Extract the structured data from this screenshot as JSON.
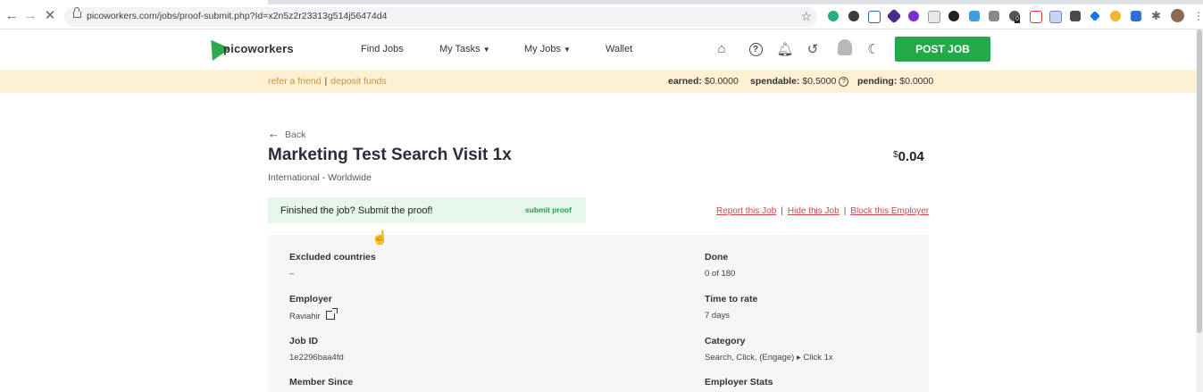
{
  "browser": {
    "url": "picoworkers.com/jobs/proof-submit.php?Id=x2n5z2r23313g514j56474d4",
    "extension_badge": "0"
  },
  "header": {
    "logo": "picoworkers",
    "nav": [
      "Find Jobs",
      "My Tasks",
      "My Jobs",
      "Wallet"
    ],
    "post_job": "POST JOB"
  },
  "balance": {
    "refer": "refer a friend",
    "separator": "|",
    "deposit": "deposit funds",
    "earned_label": "earned:",
    "earned_value": "$0.0000",
    "spendable_label": "spendable:",
    "spendable_value": "$0.5000",
    "pending_label": "pending:",
    "pending_value": "$0.0000"
  },
  "job": {
    "back": "Back",
    "title": "Marketing Test Search Visit 1x",
    "currency": "$",
    "price": "0.04",
    "region": "International - Worldwide",
    "proof_prompt": "Finished the job? Submit the proof!",
    "submit_proof": "submit proof",
    "report": "Report this Job",
    "hide": "Hide this Job",
    "block": "Block this Employer",
    "details": {
      "excluded_countries_label": "Excluded countries",
      "excluded_countries_value": "–",
      "employer_label": "Employer",
      "employer_value": "Raviahir",
      "job_id_label": "Job ID",
      "job_id_value": "1e2296baa4fd",
      "member_since_label": "Member Since",
      "done_label": "Done",
      "done_value": "0 of 180",
      "time_to_rate_label": "Time to rate",
      "time_to_rate_value": "7 days",
      "category_label": "Category",
      "category_value": "Search, Click, (Engage) ▸ Click 1x",
      "employer_stats_label": "Employer Stats"
    }
  },
  "colors": {
    "brand_green": "#25a84a",
    "balance_bg": "#fdf0d3",
    "link_gold": "#c6953d",
    "danger_red": "#d04848",
    "proof_bg": "#e5f6ec"
  },
  "icons": [
    "back-arrow-icon",
    "forward-arrow-icon",
    "stop-icon",
    "lock-icon",
    "star-icon",
    "org-chart-icon",
    "help-icon",
    "bell-icon",
    "history-icon",
    "user-avatar-icon",
    "moon-icon",
    "external-link-icon",
    "hand-cursor-icon"
  ]
}
